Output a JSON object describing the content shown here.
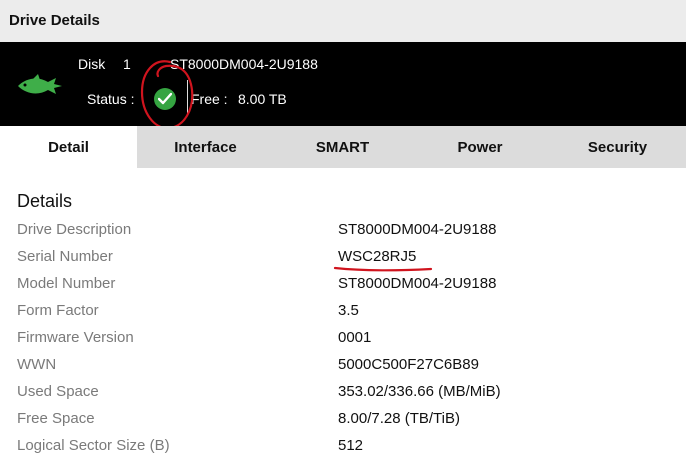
{
  "window": {
    "title": "Drive Details"
  },
  "banner": {
    "logo_text": "BARRACUDA",
    "disk_label": "Disk",
    "disk_number": "1",
    "disk_model": "ST8000DM004-2U9188",
    "status_label": "Status :",
    "status_icon": "check-circle-icon",
    "free_label": "Free :",
    "free_value": "8.00 TB"
  },
  "tabs": [
    {
      "label": "Detail",
      "active": true
    },
    {
      "label": "Interface",
      "active": false
    },
    {
      "label": "SMART",
      "active": false
    },
    {
      "label": "Power",
      "active": false
    },
    {
      "label": "Security",
      "active": false
    }
  ],
  "details": {
    "heading": "Details",
    "rows": [
      {
        "label": "Drive Description",
        "value": "ST8000DM004-2U9188"
      },
      {
        "label": "Serial Number",
        "value": "WSC28RJ5"
      },
      {
        "label": "Model Number",
        "value": "ST8000DM004-2U9188"
      },
      {
        "label": "Form Factor",
        "value": "3.5"
      },
      {
        "label": "Firmware Version",
        "value": "0001"
      },
      {
        "label": "WWN",
        "value": "5000C500F27C6B89"
      },
      {
        "label": "Used Space",
        "value": "353.02/336.66 (MB/MiB)"
      },
      {
        "label": "Free Space",
        "value": "8.00/7.28 (TB/TiB)"
      },
      {
        "label": "Logical Sector Size (B)",
        "value": "512"
      }
    ]
  },
  "colors": {
    "status_ok": "#35a441",
    "annotation": "#d0141e",
    "banner_bg": "#000000",
    "tab_bg": "#dcdcdc"
  }
}
